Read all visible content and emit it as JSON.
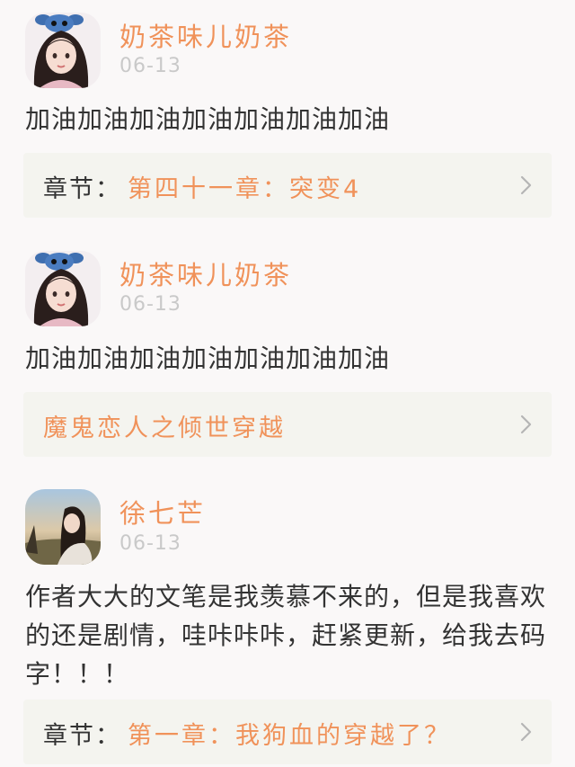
{
  "comments": [
    {
      "username": "奶茶味儿奶茶",
      "date": "06-13",
      "text": "加油加油加油加油加油加油加油",
      "chapter": {
        "prefix": "章节：",
        "title": "第四十一章：突变4"
      },
      "avatar": "girl-with-stitch-hat-avatar"
    },
    {
      "username": "奶茶味儿奶茶",
      "date": "06-13",
      "text": "加油加油加油加油加油加油加油",
      "chapter": {
        "prefix": "",
        "title": "魔鬼恋人之倾世穿越"
      },
      "avatar": "girl-with-stitch-hat-avatar"
    },
    {
      "username": "徐七芒",
      "date": "06-13",
      "text": "作者大大的文笔是我羡慕不来的，但是我喜欢的还是剧情，哇咔咔咔，赶紧更新，给我去码字！！！",
      "chapter": {
        "prefix": "章节：",
        "title": "第一章：我狗血的穿越了？"
      },
      "avatar": "girl-in-field-photo-avatar"
    }
  ],
  "colors": {
    "accent": "#f0925a",
    "date": "#c9c9c9",
    "card": "#f4f4ef",
    "background": "#faf8f8"
  }
}
